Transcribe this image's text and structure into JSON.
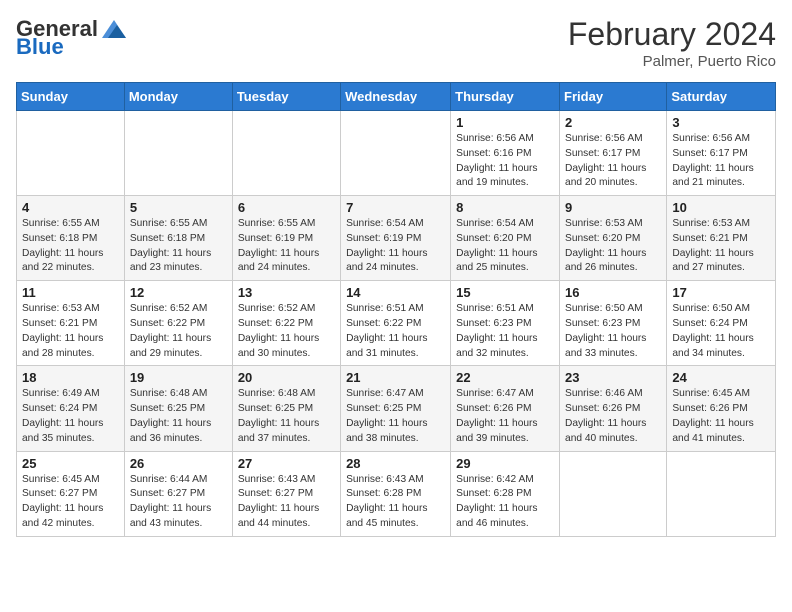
{
  "header": {
    "logo_general": "General",
    "logo_blue": "Blue",
    "month_title": "February 2024",
    "location": "Palmer, Puerto Rico"
  },
  "days_of_week": [
    "Sunday",
    "Monday",
    "Tuesday",
    "Wednesday",
    "Thursday",
    "Friday",
    "Saturday"
  ],
  "weeks": [
    [
      null,
      null,
      null,
      null,
      {
        "day": 1,
        "sunrise": "6:56 AM",
        "sunset": "6:16 PM",
        "daylight": "11 hours and 19 minutes."
      },
      {
        "day": 2,
        "sunrise": "6:56 AM",
        "sunset": "6:17 PM",
        "daylight": "11 hours and 20 minutes."
      },
      {
        "day": 3,
        "sunrise": "6:56 AM",
        "sunset": "6:17 PM",
        "daylight": "11 hours and 21 minutes."
      }
    ],
    [
      {
        "day": 4,
        "sunrise": "6:55 AM",
        "sunset": "6:18 PM",
        "daylight": "11 hours and 22 minutes."
      },
      {
        "day": 5,
        "sunrise": "6:55 AM",
        "sunset": "6:18 PM",
        "daylight": "11 hours and 23 minutes."
      },
      {
        "day": 6,
        "sunrise": "6:55 AM",
        "sunset": "6:19 PM",
        "daylight": "11 hours and 24 minutes."
      },
      {
        "day": 7,
        "sunrise": "6:54 AM",
        "sunset": "6:19 PM",
        "daylight": "11 hours and 24 minutes."
      },
      {
        "day": 8,
        "sunrise": "6:54 AM",
        "sunset": "6:20 PM",
        "daylight": "11 hours and 25 minutes."
      },
      {
        "day": 9,
        "sunrise": "6:53 AM",
        "sunset": "6:20 PM",
        "daylight": "11 hours and 26 minutes."
      },
      {
        "day": 10,
        "sunrise": "6:53 AM",
        "sunset": "6:21 PM",
        "daylight": "11 hours and 27 minutes."
      }
    ],
    [
      {
        "day": 11,
        "sunrise": "6:53 AM",
        "sunset": "6:21 PM",
        "daylight": "11 hours and 28 minutes."
      },
      {
        "day": 12,
        "sunrise": "6:52 AM",
        "sunset": "6:22 PM",
        "daylight": "11 hours and 29 minutes."
      },
      {
        "day": 13,
        "sunrise": "6:52 AM",
        "sunset": "6:22 PM",
        "daylight": "11 hours and 30 minutes."
      },
      {
        "day": 14,
        "sunrise": "6:51 AM",
        "sunset": "6:22 PM",
        "daylight": "11 hours and 31 minutes."
      },
      {
        "day": 15,
        "sunrise": "6:51 AM",
        "sunset": "6:23 PM",
        "daylight": "11 hours and 32 minutes."
      },
      {
        "day": 16,
        "sunrise": "6:50 AM",
        "sunset": "6:23 PM",
        "daylight": "11 hours and 33 minutes."
      },
      {
        "day": 17,
        "sunrise": "6:50 AM",
        "sunset": "6:24 PM",
        "daylight": "11 hours and 34 minutes."
      }
    ],
    [
      {
        "day": 18,
        "sunrise": "6:49 AM",
        "sunset": "6:24 PM",
        "daylight": "11 hours and 35 minutes."
      },
      {
        "day": 19,
        "sunrise": "6:48 AM",
        "sunset": "6:25 PM",
        "daylight": "11 hours and 36 minutes."
      },
      {
        "day": 20,
        "sunrise": "6:48 AM",
        "sunset": "6:25 PM",
        "daylight": "11 hours and 37 minutes."
      },
      {
        "day": 21,
        "sunrise": "6:47 AM",
        "sunset": "6:25 PM",
        "daylight": "11 hours and 38 minutes."
      },
      {
        "day": 22,
        "sunrise": "6:47 AM",
        "sunset": "6:26 PM",
        "daylight": "11 hours and 39 minutes."
      },
      {
        "day": 23,
        "sunrise": "6:46 AM",
        "sunset": "6:26 PM",
        "daylight": "11 hours and 40 minutes."
      },
      {
        "day": 24,
        "sunrise": "6:45 AM",
        "sunset": "6:26 PM",
        "daylight": "11 hours and 41 minutes."
      }
    ],
    [
      {
        "day": 25,
        "sunrise": "6:45 AM",
        "sunset": "6:27 PM",
        "daylight": "11 hours and 42 minutes."
      },
      {
        "day": 26,
        "sunrise": "6:44 AM",
        "sunset": "6:27 PM",
        "daylight": "11 hours and 43 minutes."
      },
      {
        "day": 27,
        "sunrise": "6:43 AM",
        "sunset": "6:27 PM",
        "daylight": "11 hours and 44 minutes."
      },
      {
        "day": 28,
        "sunrise": "6:43 AM",
        "sunset": "6:28 PM",
        "daylight": "11 hours and 45 minutes."
      },
      {
        "day": 29,
        "sunrise": "6:42 AM",
        "sunset": "6:28 PM",
        "daylight": "11 hours and 46 minutes."
      },
      null,
      null
    ]
  ]
}
